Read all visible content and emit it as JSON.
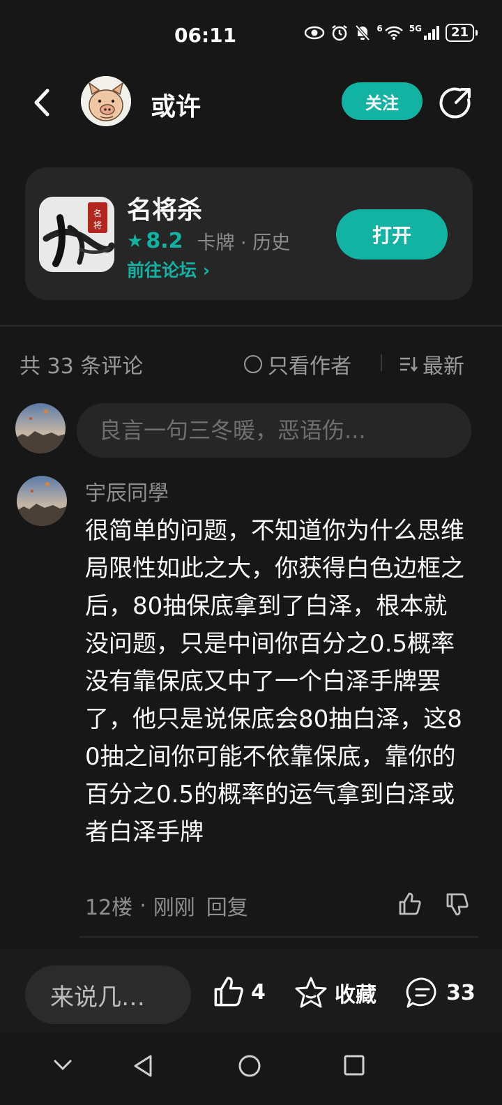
{
  "status_bar": {
    "time": "06:11",
    "signal": "5G",
    "signal_extra": "6",
    "battery": "21"
  },
  "header": {
    "title": "或许",
    "follow_label": "关注"
  },
  "game": {
    "name": "名将杀",
    "rating": "8.2",
    "tags": "卡牌 · 历史",
    "forum_link": "前往论坛",
    "open_label": "打开",
    "icon_text": "名将"
  },
  "comments_bar": {
    "count_text": "共 33 条评论",
    "author_only": "只看作者",
    "sort_label": "最新"
  },
  "comment_input": {
    "placeholder": "良言一句三冬暖，恶语伤..."
  },
  "comment": {
    "user": "宇辰同學",
    "body": "很简单的问题，不知道你为什么思维局限性如此之大，你获得白色边框之后，80抽保底拿到了白泽，根本就没问题，只是中间你百分之0.5概率没有靠保底又中了一个白泽手牌罢了，他只是说保底会80抽白泽，这80抽之间你可能不依靠保底，靠你的百分之0.5的概率的运气拿到白泽或者白泽手牌",
    "floor": "12楼",
    "time": "刚刚",
    "reply_label": "回复"
  },
  "bottom_bar": {
    "input_placeholder": "来说几…",
    "likes": "4",
    "favorite_label": "收藏",
    "comments": "33"
  },
  "colors": {
    "accent": "#12b3a3",
    "background": "#171717",
    "card": "#262626"
  }
}
